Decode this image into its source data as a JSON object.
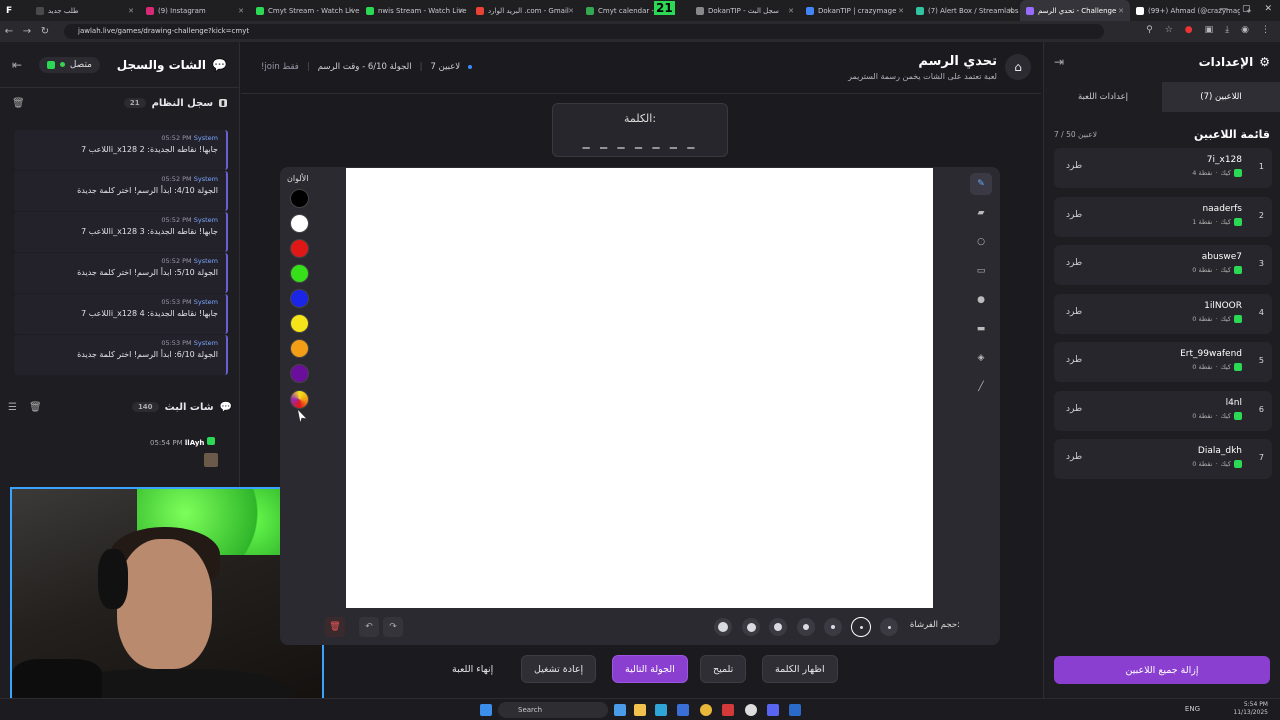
{
  "browser": {
    "tabs": [
      {
        "title": "طلب جديد",
        "color": "#4a4a4a"
      },
      {
        "title": "(9) Instagram",
        "color": "#d62976"
      },
      {
        "title": "Cmyt Stream - Watch Live",
        "color": "#2bd955"
      },
      {
        "title": "nwis Stream - Watch Live",
        "color": "#2bd955"
      },
      {
        "title": "البريد الوارد .com - Gmail",
        "color": "#ea4335"
      },
      {
        "title": "Cmyt calendar - بيانات",
        "color": "#34a853"
      },
      {
        "title": "DokanTIP - سجل البث",
        "color": "#888888"
      },
      {
        "title": "DokanTIP | crazymage",
        "color": "#4285f4"
      },
      {
        "title": "(7) Alert Box / Streamlabs",
        "color": "#31c3a2"
      },
      {
        "title": "تحدي الرسم - Challenge",
        "color": "#9a6bff"
      },
      {
        "title": "(99+) Ahmad (@crazymage",
        "color": "#ffffff"
      }
    ],
    "tab_overlay_number": "21",
    "url": "jawlah.live/games/drawing-challenge?kick=cmyt"
  },
  "left_panel": {
    "title": "الشات والسجل",
    "status": "متصل",
    "system_log": {
      "title": "سجل النظام",
      "count": "21",
      "messages": [
        {
          "sender": "System",
          "time": "05:52 PM",
          "text": "اللاعب 7i_x128 جابها! نقاطه الجديدة: 2"
        },
        {
          "sender": "System",
          "time": "05:52 PM",
          "text": "الجولة 4/10: ابدأ الرسم! اختر كلمة جديدة"
        },
        {
          "sender": "System",
          "time": "05:52 PM",
          "text": "اللاعب 7i_x128 جابها! نقاطه الجديدة: 3"
        },
        {
          "sender": "System",
          "time": "05:52 PM",
          "text": "الجولة 5/10: ابدأ الرسم! اختر كلمة جديدة"
        },
        {
          "sender": "System",
          "time": "05:53 PM",
          "text": "اللاعب 7i_x128 جابها! نقاطه الجديدة: 4"
        },
        {
          "sender": "System",
          "time": "05:53 PM",
          "text": "الجولة 6/10: ابدأ الرسم! اختر كلمة جديدة"
        }
      ]
    },
    "stream_chat": {
      "title": "شات البث",
      "count": "140",
      "last_user": "llAyh",
      "last_time": "05:54 PM"
    }
  },
  "main": {
    "game_title": "تحدي الرسم",
    "game_subtitle": "لعبة تعتمد على الشات يخمن رسمة الستريمر",
    "players_count": "7 لاعبين",
    "round": "الجولة 6/10 - وقت الرسم",
    "join_hint": "!join فقط",
    "word_label": "الكلمة:",
    "word_blanks": "_ _ _ _ _ _ _",
    "colors_label": "الألوان",
    "colors": [
      "#000000",
      "#ffffff",
      "#e01717",
      "#35e01a",
      "#1a25e6",
      "#f5e41a",
      "#f49d17",
      "#6a0e9c"
    ],
    "brush_size_label": "حجم الفرشاة:",
    "buttons": {
      "reveal_word": "اظهار الكلمة",
      "hint": "تلميح",
      "next_round": "الجولة التالية",
      "restart": "إعادة تشغيل",
      "end_game": "إنهاء اللعبة"
    }
  },
  "right_panel": {
    "title": "الإعدادات",
    "tabs": [
      "اللاعبين (7)",
      "إعدادات اللعبة"
    ],
    "list_title": "قائمة اللاعبين",
    "list_count": "7 / 50 لاعبين",
    "kick_label": "طرد",
    "platform": "كيك",
    "players": [
      {
        "rank": "1",
        "name": "7i_x128",
        "points": "4 نقطة"
      },
      {
        "rank": "2",
        "name": "naaderfs",
        "points": "1 نقطة"
      },
      {
        "rank": "3",
        "name": "abuswe7",
        "points": "0 نقطة"
      },
      {
        "rank": "4",
        "name": "1ilNOOR",
        "points": "0 نقطة"
      },
      {
        "rank": "5",
        "name": "Ert_99wafend",
        "points": "0 نقطة"
      },
      {
        "rank": "6",
        "name": "l4nl",
        "points": "0 نقطة"
      },
      {
        "rank": "7",
        "name": "Diala_dkh",
        "points": "0 نقطة"
      }
    ],
    "remove_all": "إزالة جميع اللاعبين"
  },
  "taskbar": {
    "search": "Search",
    "lang": "ENG",
    "time": "5:54 PM",
    "date": "11/13/2025"
  }
}
